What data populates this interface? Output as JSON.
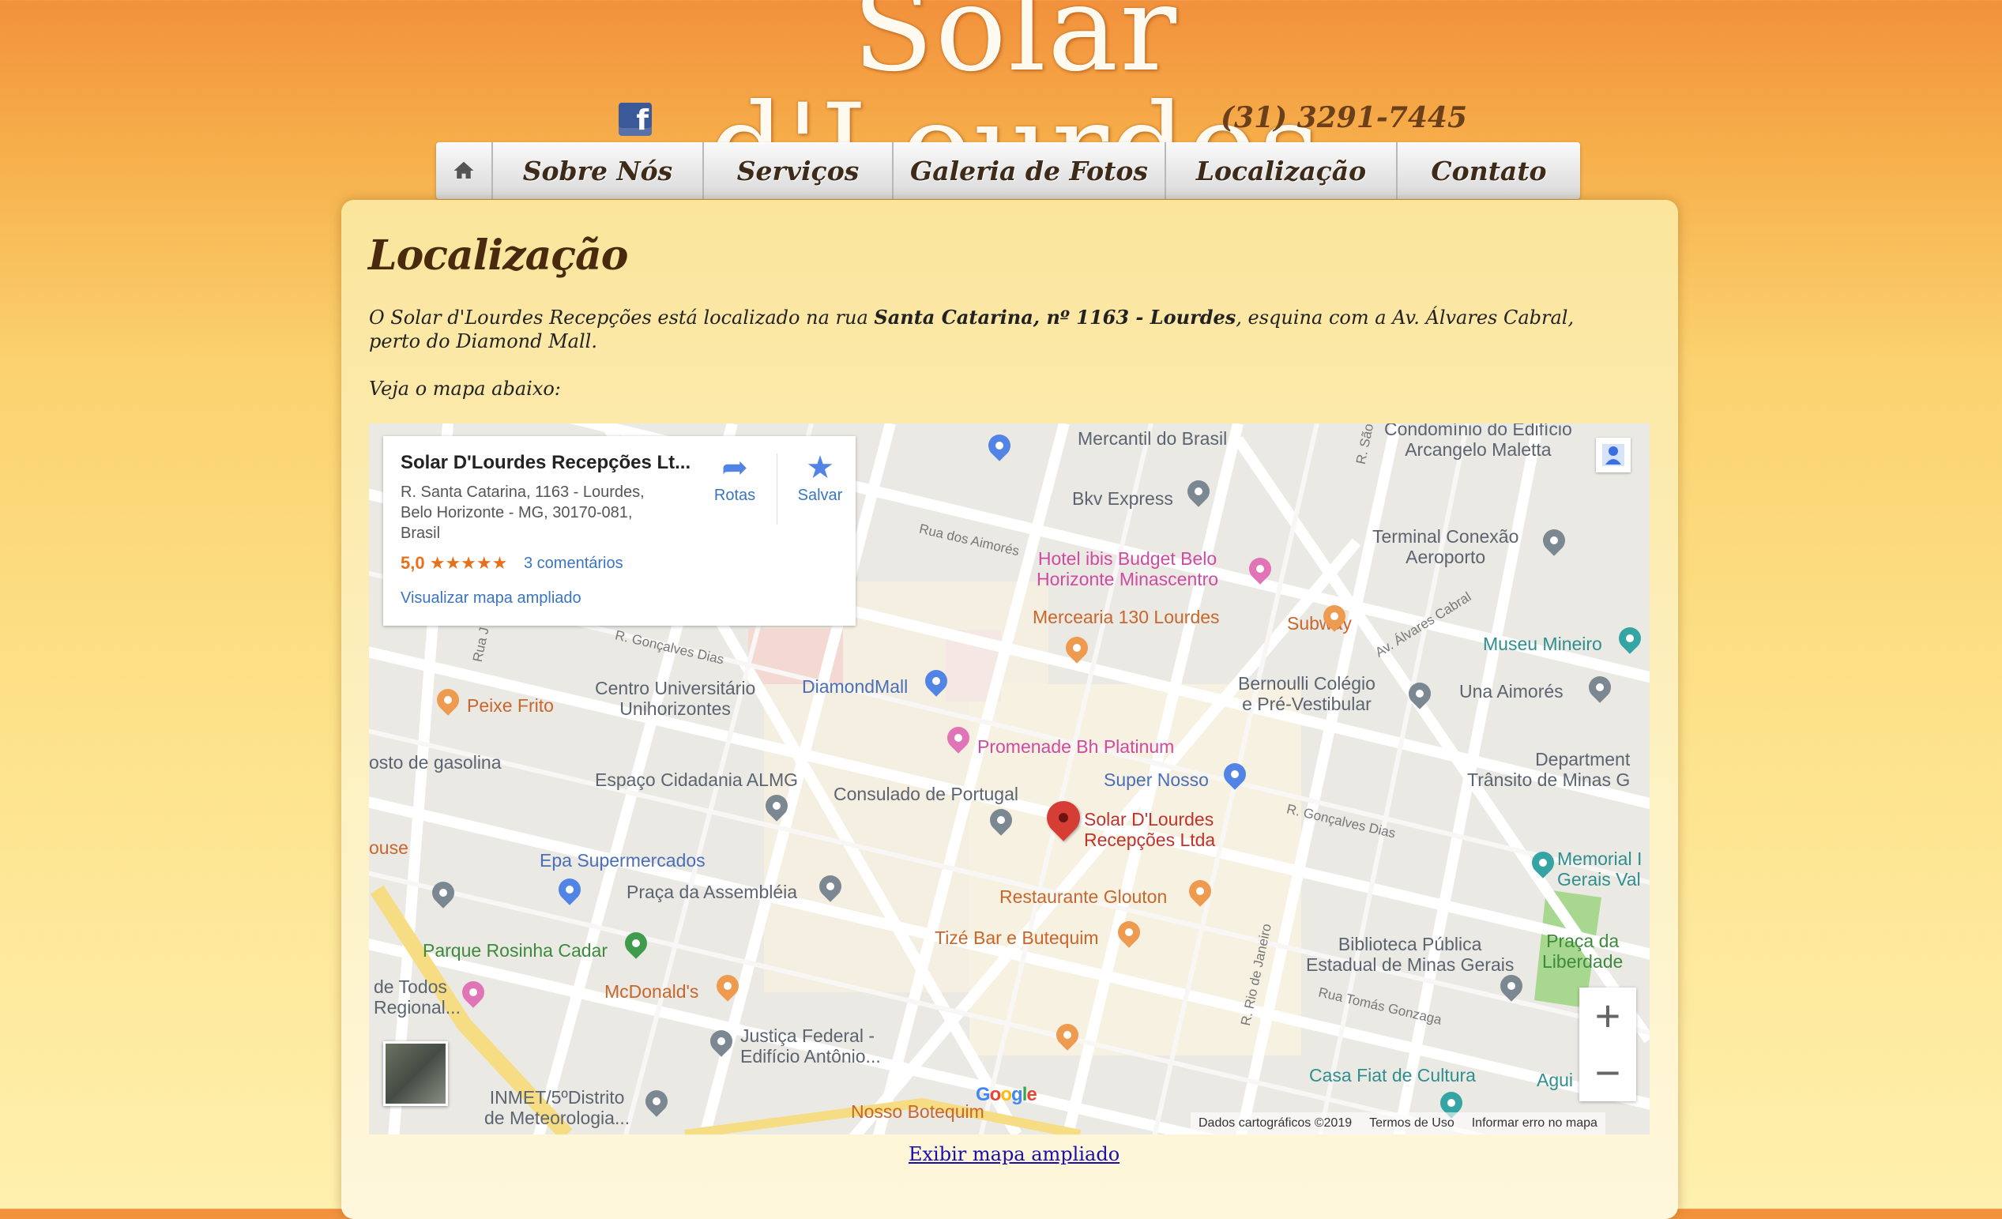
{
  "site": {
    "logo_text": "Solar d'Lourdes",
    "phone": "(31) 3291-7445",
    "facebook_icon": "facebook-icon"
  },
  "nav": {
    "home_icon": "home-icon",
    "items": [
      "Sobre Nós",
      "Serviços",
      "Galeria de Fotos",
      "Localização",
      "Contato"
    ]
  },
  "content": {
    "title": "Localização",
    "para1_start": "O Solar d'Lourdes Recepções está localizado na rua ",
    "para1_bold": "Santa Catarina, nº 1163 - Lourdes",
    "para1_end": ", esquina com a Av. Álvares Cabral, perto do Diamond Mall.",
    "para2": "Veja o mapa abaixo:",
    "map_link": "Exibir mapa ampliado"
  },
  "map": {
    "card": {
      "title": "Solar D'Lourdes Recepções Lt...",
      "address_line1": "R. Santa Catarina, 1163 - Lourdes,",
      "address_line2": "Belo Horizonte - MG, 30170-081,",
      "address_line3": "Brasil",
      "rating": "5,0",
      "stars": "★★★★★",
      "reviews": "3 comentários",
      "view_larger": "Visualizar mapa ampliado",
      "directions": "Rotas",
      "save": "Salvar"
    },
    "places": {
      "mercantil": "Mercantil do Brasil",
      "condominio1": "Condomínio do Edifício",
      "condominio2": "Arcangelo Maletta",
      "bkv": "Bkv Express",
      "ibis1": "Hotel ibis Budget Belo",
      "ibis2": "Horizonte Minascentro",
      "terminal1": "Terminal Conexão",
      "terminal2": "Aeroporto",
      "mercearia": "Mercearia 130 Lourdes",
      "subway": "Subway",
      "museu": "Museu Mineiro",
      "centro1": "Centro Universitário",
      "centro2": "Unihorizontes",
      "diamond": "DiamondMall",
      "bernoulli1": "Bernoulli Colégio",
      "bernoulli2": "e Pré-Vestibular",
      "una": "Una Aimorés",
      "peixe": "Peixe Frito",
      "promenade": "Promenade Bh Platinum",
      "posto": "osto de gasolina",
      "espaco": "Espaço Cidadania ALMG",
      "supernosso": "Super Nosso",
      "departamento1": "Department",
      "departamento2": "Trânsito de Minas G",
      "consulado": "Consulado de Portugal",
      "solar1": "Solar D'Lourdes",
      "solar2": "Recepções Ltda",
      "ouse": "ouse",
      "epa": "Epa Supermercados",
      "praca_assembleia": "Praça da Assembléia",
      "memorial1": "Memorial I",
      "memorial2": "Gerais Val",
      "glouton": "Restaurante Glouton",
      "parque": "Parque Rosinha Cadar",
      "tize": "Tizé Bar e Butequim",
      "biblioteca1": "Biblioteca Pública",
      "biblioteca2": "Estadual de Minas Gerais",
      "praca_liberdade1": "Praça da",
      "praca_liberdade2": "Liberdade",
      "todos1": "de Todos",
      "todos2": "Regional...",
      "mcdonalds": "McDonald's",
      "justica1": "Justiça Federal -",
      "justica2": "Edifício Antônio...",
      "fiat": "Casa Fiat de Cultura",
      "agui": "Agui",
      "inmet1": "INMET/5ºDistrito",
      "inmet2": "de Meteorologia...",
      "botequim": "Nosso Botequim"
    },
    "streets": {
      "aimores": "Rua dos Aimorés",
      "goncalves1": "R. Gonçalves Dias",
      "goncalves2": "R. Gonçalves Dias",
      "alvares": "Av. Álvares Cabral",
      "tomas": "Rua Tomás Gonzaga",
      "riojaneiro": "R. Rio de Janeiro",
      "sao": "R. São",
      "rua_j": "Rua J"
    },
    "zoom_in": "+",
    "zoom_out": "−",
    "footer": [
      "Dados cartográficos ©2019",
      "Termos de Uso",
      "Informar erro no mapa"
    ],
    "google": "Google"
  }
}
